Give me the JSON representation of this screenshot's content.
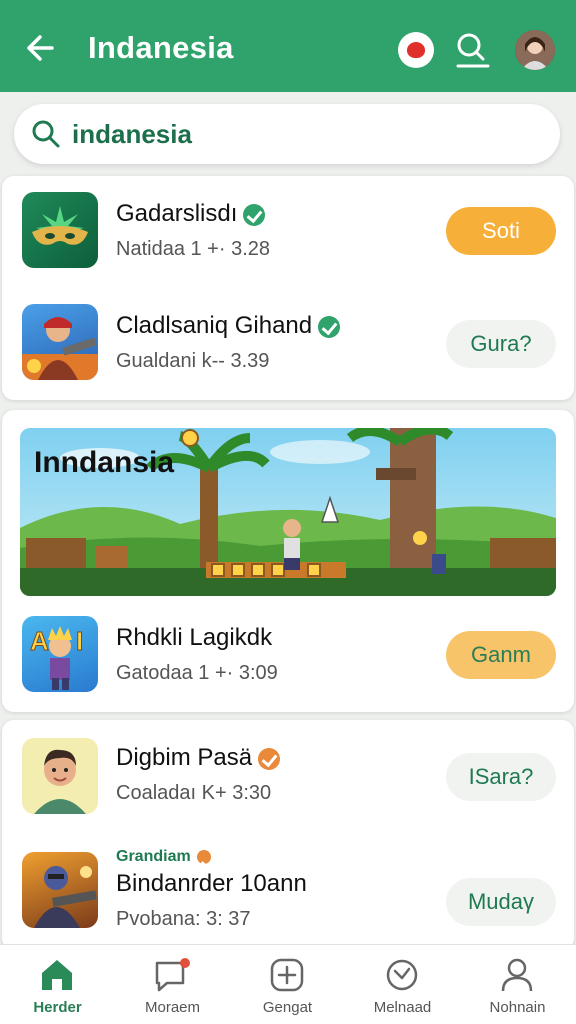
{
  "header": {
    "title": "Indanesia",
    "back_icon": "arrow-left-icon",
    "notification_icon": "notification-icon",
    "search_icon": "search-icon",
    "profile_icon": "avatar"
  },
  "search": {
    "value": "indanesia",
    "placeholder": ""
  },
  "apps": [
    {
      "name": "Gadarslisdı",
      "meta": "Natidaa 1 +· 3.28",
      "button": "Soti",
      "icon": "mask-icon"
    },
    {
      "name": "Cladlsaniq Gihand",
      "meta": "Gualdani k-- 3.39",
      "button": "Gura?",
      "icon": "warrior-icon"
    }
  ],
  "banner": {
    "title": "Inndansia"
  },
  "featured_app": {
    "name": "Rhdkli Lagikdk",
    "meta": "Gatodaa 1 +· 3:09",
    "button": "Ganm",
    "icon": "character-icon"
  },
  "more_apps": [
    {
      "name": "Digbim Pasä",
      "meta": "Coaladaı K+ 3:30",
      "button": "ISara?",
      "icon": "face-icon"
    },
    {
      "tag": "Grandiam",
      "name": "Bindanrder 10ann",
      "meta": "Pvobana: 3: 37",
      "button": "Mudaγ",
      "icon": "soldier-icon"
    }
  ],
  "bottom_nav": [
    {
      "label": "Herder",
      "icon": "home-icon",
      "active": true
    },
    {
      "label": "Moraem",
      "icon": "message-icon",
      "active": false
    },
    {
      "label": "Gengat",
      "icon": "plus-square-icon",
      "active": false
    },
    {
      "label": "Melnaad",
      "icon": "clock-icon",
      "active": false
    },
    {
      "label": "Nohnain",
      "icon": "person-icon",
      "active": false
    }
  ],
  "colors": {
    "primary": "#2fa36b",
    "accent": "#f6b03a",
    "background": "#eef0ee"
  }
}
